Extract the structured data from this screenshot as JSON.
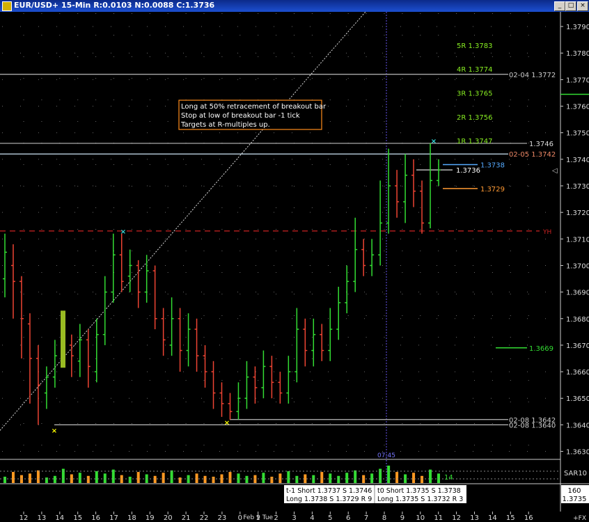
{
  "window": {
    "title": "EUR/USD+ 15-Min R:0.0103 N:0.0088 C:1.3736",
    "minimize_label": "_",
    "maximize_label": "□",
    "close_label": "×"
  },
  "colors": {
    "up": "#33dd33",
    "down": "#ee4433",
    "grid": "#6a6a6a",
    "annotation_border": "#ff8c1a",
    "target_text": "#88ee22",
    "yh_line": "#cc2222",
    "stop_line": "#ff9933",
    "entry_line": "#55aaff",
    "marker": "#33dddd",
    "low_marker": "#ffff00"
  },
  "annotation": {
    "lines": [
      "Long at 50% retracement of breakout bar",
      "Stop at low of breakout bar -1 tick",
      "Targets at R-multiples up."
    ]
  },
  "chart_data": {
    "type": "bar",
    "title": "EUR/USD+ 15-Min",
    "price_axis": {
      "ylim": [
        1.3627,
        1.3795
      ],
      "ticks": [
        "1.3630",
        "1.3640",
        "1.3650",
        "1.3660",
        "1.3670",
        "1.3680",
        "1.3690",
        "1.3700",
        "1.3710",
        "1.3720",
        "1.3730",
        "1.3740",
        "1.3750",
        "1.3760",
        "1.3770",
        "1.3780",
        "1.3790"
      ]
    },
    "time_axis": {
      "labels": [
        "12",
        "13",
        "14",
        "15",
        "16",
        "17",
        "18",
        "19",
        "20",
        "21",
        "22",
        "23",
        "0",
        "1",
        "2",
        "3",
        "4",
        "5",
        "6",
        "7",
        "8",
        "9",
        "10",
        "11",
        "12",
        "13",
        "14",
        "15",
        "16"
      ],
      "sublabel": "Feb 9 Tue",
      "cursor_label": "07:45"
    },
    "bars": [
      [
        1.3695,
        1.3705,
        1.3712,
        1.3688
      ],
      [
        1.37,
        1.3694,
        1.3708,
        1.368
      ],
      [
        1.3694,
        1.368,
        1.3696,
        1.3665
      ],
      [
        1.3678,
        1.3665,
        1.3682,
        1.3648
      ],
      [
        1.3665,
        1.3655,
        1.367,
        1.364
      ],
      [
        1.3652,
        1.3658,
        1.3662,
        1.3646
      ],
      [
        1.3658,
        1.3666,
        1.3672,
        1.3654
      ],
      [
        1.3668,
        1.3674,
        1.3682,
        1.3664
      ],
      [
        1.367,
        1.3666,
        1.3674,
        1.3658
      ],
      [
        1.3664,
        1.3672,
        1.3678,
        1.3658
      ],
      [
        1.3672,
        1.3662,
        1.3676,
        1.3654
      ],
      [
        1.366,
        1.3674,
        1.368,
        1.3656
      ],
      [
        1.3674,
        1.369,
        1.3696,
        1.367
      ],
      [
        1.369,
        1.3704,
        1.3712,
        1.3686
      ],
      [
        1.3704,
        1.3694,
        1.3712,
        1.369
      ],
      [
        1.3696,
        1.37,
        1.3706,
        1.369
      ],
      [
        1.37,
        1.369,
        1.3702,
        1.3684
      ],
      [
        1.369,
        1.3698,
        1.3704,
        1.3686
      ],
      [
        1.3698,
        1.368,
        1.37,
        1.3676
      ],
      [
        1.368,
        1.3672,
        1.3684,
        1.3666
      ],
      [
        1.367,
        1.368,
        1.3688,
        1.3666
      ],
      [
        1.368,
        1.3668,
        1.3684,
        1.366
      ],
      [
        1.3668,
        1.3676,
        1.3682,
        1.3662
      ],
      [
        1.3676,
        1.3666,
        1.368,
        1.366
      ],
      [
        1.3666,
        1.366,
        1.367,
        1.3654
      ],
      [
        1.366,
        1.3652,
        1.3664,
        1.3646
      ],
      [
        1.3652,
        1.3648,
        1.3656,
        1.3643
      ],
      [
        1.3648,
        1.3645,
        1.3652,
        1.3642
      ],
      [
        1.3645,
        1.365,
        1.3656,
        1.3642
      ],
      [
        1.365,
        1.3658,
        1.3664,
        1.3646
      ],
      [
        1.3658,
        1.3654,
        1.3662,
        1.3648
      ],
      [
        1.3654,
        1.3662,
        1.3668,
        1.365
      ],
      [
        1.3662,
        1.3656,
        1.3666,
        1.365
      ],
      [
        1.3656,
        1.3652,
        1.366,
        1.3648
      ],
      [
        1.3652,
        1.366,
        1.3666,
        1.3648
      ],
      [
        1.366,
        1.3676,
        1.3684,
        1.3656
      ],
      [
        1.3676,
        1.3668,
        1.368,
        1.3662
      ],
      [
        1.3668,
        1.3674,
        1.368,
        1.3662
      ],
      [
        1.3674,
        1.3668,
        1.3678,
        1.3664
      ],
      [
        1.3668,
        1.3676,
        1.3684,
        1.3664
      ],
      [
        1.3676,
        1.3686,
        1.3692,
        1.3672
      ],
      [
        1.3686,
        1.3694,
        1.37,
        1.3682
      ],
      [
        1.3694,
        1.3706,
        1.3718,
        1.369
      ],
      [
        1.3706,
        1.37,
        1.371,
        1.3696
      ],
      [
        1.37,
        1.3704,
        1.371,
        1.3696
      ],
      [
        1.3704,
        1.3716,
        1.3732,
        1.37
      ],
      [
        1.3716,
        1.373,
        1.3744,
        1.3712
      ],
      [
        1.373,
        1.3724,
        1.3736,
        1.3718
      ],
      [
        1.3724,
        1.3734,
        1.3742,
        1.3716
      ],
      [
        1.3734,
        1.3728,
        1.374,
        1.3722
      ],
      [
        1.3728,
        1.3716,
        1.3732,
        1.3712
      ],
      [
        1.3716,
        1.3732,
        1.3746,
        1.3714
      ],
      [
        1.3732,
        1.3736,
        1.374,
        1.373
      ]
    ],
    "volume": [
      8,
      14,
      10,
      12,
      16,
      7,
      9,
      18,
      11,
      13,
      9,
      15,
      12,
      17,
      10,
      8,
      14,
      11,
      9,
      13,
      16,
      7,
      10,
      12,
      9,
      8,
      11,
      14,
      12,
      9,
      10,
      13,
      8,
      12,
      15,
      9,
      11,
      10,
      14,
      12,
      9,
      13,
      16,
      10,
      12,
      18,
      22,
      14,
      11,
      13,
      9,
      17,
      12
    ],
    "levels": [
      {
        "name": "02-04",
        "label": "02-04 1.3772",
        "price": 1.3772
      },
      {
        "name": "02-05",
        "label": "02-05 1.3742",
        "price": 1.3742
      },
      {
        "name": "bar-high",
        "label": "1.3746",
        "price": 1.3746
      },
      {
        "name": "last",
        "label": "1.3736",
        "price": 1.3736
      },
      {
        "name": "entry",
        "label": "1.3738",
        "price": 1.3738
      },
      {
        "name": "stop",
        "label": "1.3729",
        "price": 1.3729
      },
      {
        "name": "yh",
        "label": "YH",
        "price": 1.3713
      },
      {
        "name": "level-3669",
        "label": "1.3669",
        "price": 1.3669
      },
      {
        "name": "02-08-high",
        "label": "02-08 1.3642",
        "price": 1.3642
      },
      {
        "name": "02-08-low",
        "label": "02-08 1.3640",
        "price": 1.364
      }
    ],
    "targets": [
      {
        "label": "5R 1.3783",
        "price": 1.3783
      },
      {
        "label": "4R 1.3774",
        "price": 1.3774
      },
      {
        "label": "3R 1.3765",
        "price": 1.3765
      },
      {
        "label": "2R 1.3756",
        "price": 1.3756
      },
      {
        "label": "1R 1.3747",
        "price": 1.3747
      }
    ],
    "info_box": {
      "prev": [
        "t-1 Short 1.3737  S 1.3746",
        "Long 1.3738  S 1.3729  R 9"
      ],
      "curr": [
        "t0 Short 1.3735  S 1.3738",
        "Long 1.3735  S 1.3732  R 3"
      ]
    },
    "indicator_labels": {
      "sar": "SAR10",
      "value": "14",
      "sar_count": "160",
      "sar_price": "1.3735",
      "corner": "+FX"
    }
  }
}
